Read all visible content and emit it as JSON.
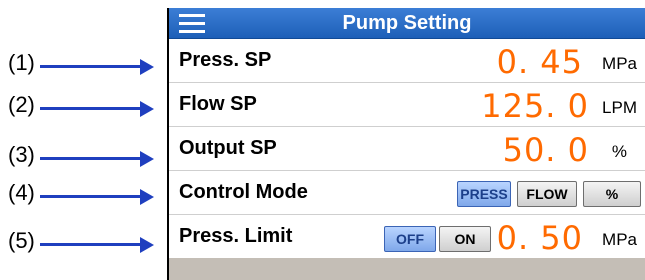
{
  "callouts": [
    "(1)",
    "(2)",
    "(3)",
    "(4)",
    "(5)"
  ],
  "header": {
    "title": "Pump Setting"
  },
  "rows": {
    "pressure_sp": {
      "label": "Press. SP",
      "value": "0. 45",
      "unit": "MPa"
    },
    "flow_sp": {
      "label": "Flow SP",
      "value": "125. 0",
      "unit": "LPM"
    },
    "output_sp": {
      "label": "Output SP",
      "value": "50. 0",
      "unit": "%"
    },
    "control_mode": {
      "label": "Control Mode",
      "options": [
        "PRESS",
        "FLOW",
        "%"
      ],
      "selected": "PRESS"
    },
    "press_limit": {
      "label": "Press. Limit",
      "toggle": [
        "OFF",
        "ON"
      ],
      "selected": "OFF",
      "value": "0. 50",
      "unit": "MPa"
    }
  },
  "colors": {
    "header": "#2a6cc8",
    "value": "#ff6a00",
    "arrow": "#1f3fbf",
    "active_button": "#9cbcf4"
  }
}
